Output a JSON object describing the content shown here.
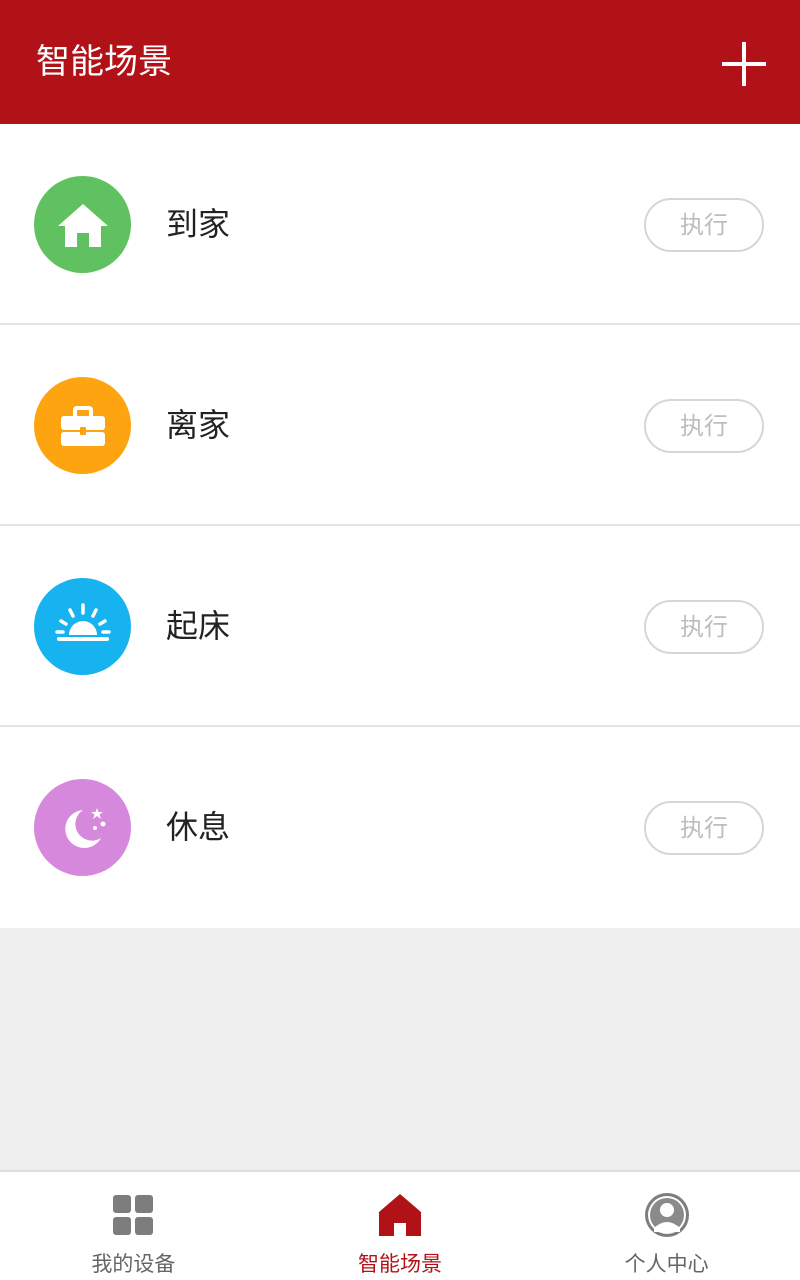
{
  "header": {
    "title": "智能场景",
    "add_icon": "plus-icon"
  },
  "scenes": [
    {
      "label": "到家",
      "icon": "home-icon",
      "color": "#5fc15f",
      "button": "执行"
    },
    {
      "label": "离家",
      "icon": "briefcase-icon",
      "color": "#ffa411",
      "button": "执行"
    },
    {
      "label": "起床",
      "icon": "sunrise-icon",
      "color": "#17b2f0",
      "button": "执行"
    },
    {
      "label": "休息",
      "icon": "moon-icon",
      "color": "#d689dc",
      "button": "执行"
    }
  ],
  "tabbar": {
    "items": [
      {
        "label": "我的设备",
        "icon": "grid-icon",
        "active": false
      },
      {
        "label": "智能场景",
        "icon": "home-icon",
        "active": true
      },
      {
        "label": "个人中心",
        "icon": "user-icon",
        "active": false
      }
    ]
  },
  "colors": {
    "brand": "#b11217",
    "inactive_tab": "#666666",
    "button_text": "#bdbdbd"
  }
}
